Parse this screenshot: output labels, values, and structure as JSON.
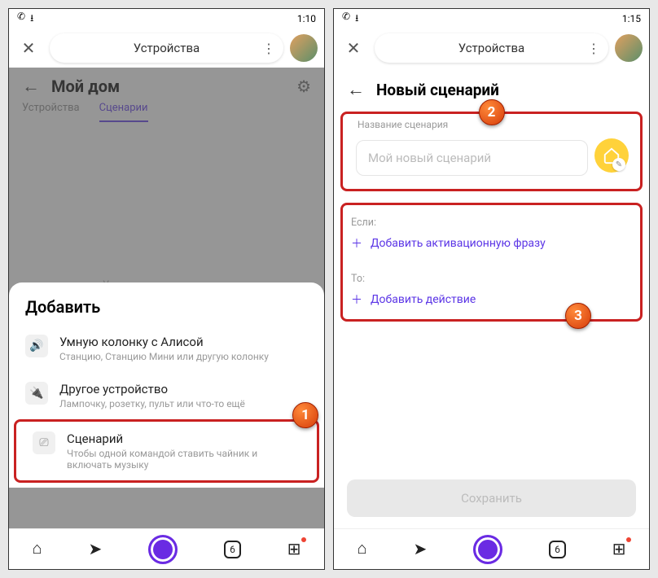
{
  "left": {
    "status_time": "1:10",
    "topbar_title": "Устройства",
    "home_title": "Мой дом",
    "tabs": [
      "Устройства",
      "Сценарии"
    ],
    "active_tab": 1,
    "empty_text": "У вас пока нет сценариев",
    "sheet_title": "Добавить",
    "sheet_items": [
      {
        "title": "Умную колонку с Алисой",
        "sub": "Станцию, Станцию Мини или другую колонку"
      },
      {
        "title": "Другое устройство",
        "sub": "Лампочку, розетку, пульт или что-то ещё"
      },
      {
        "title": "Сценарий",
        "sub": "Чтобы одной командой ставить чайник и включать музыку"
      }
    ],
    "badge1": "1"
  },
  "right": {
    "status_time": "1:15",
    "topbar_title": "Устройства",
    "page_title": "Новый сценарий",
    "name_label": "Название сценария",
    "name_placeholder": "Мой новый сценарий",
    "if_label": "Если:",
    "add_phrase": "Добавить активационную фразу",
    "then_label": "То:",
    "add_action": "Добавить действие",
    "save_label": "Сохранить",
    "badge2": "2",
    "badge3": "3"
  },
  "nav_badge_count": "6"
}
